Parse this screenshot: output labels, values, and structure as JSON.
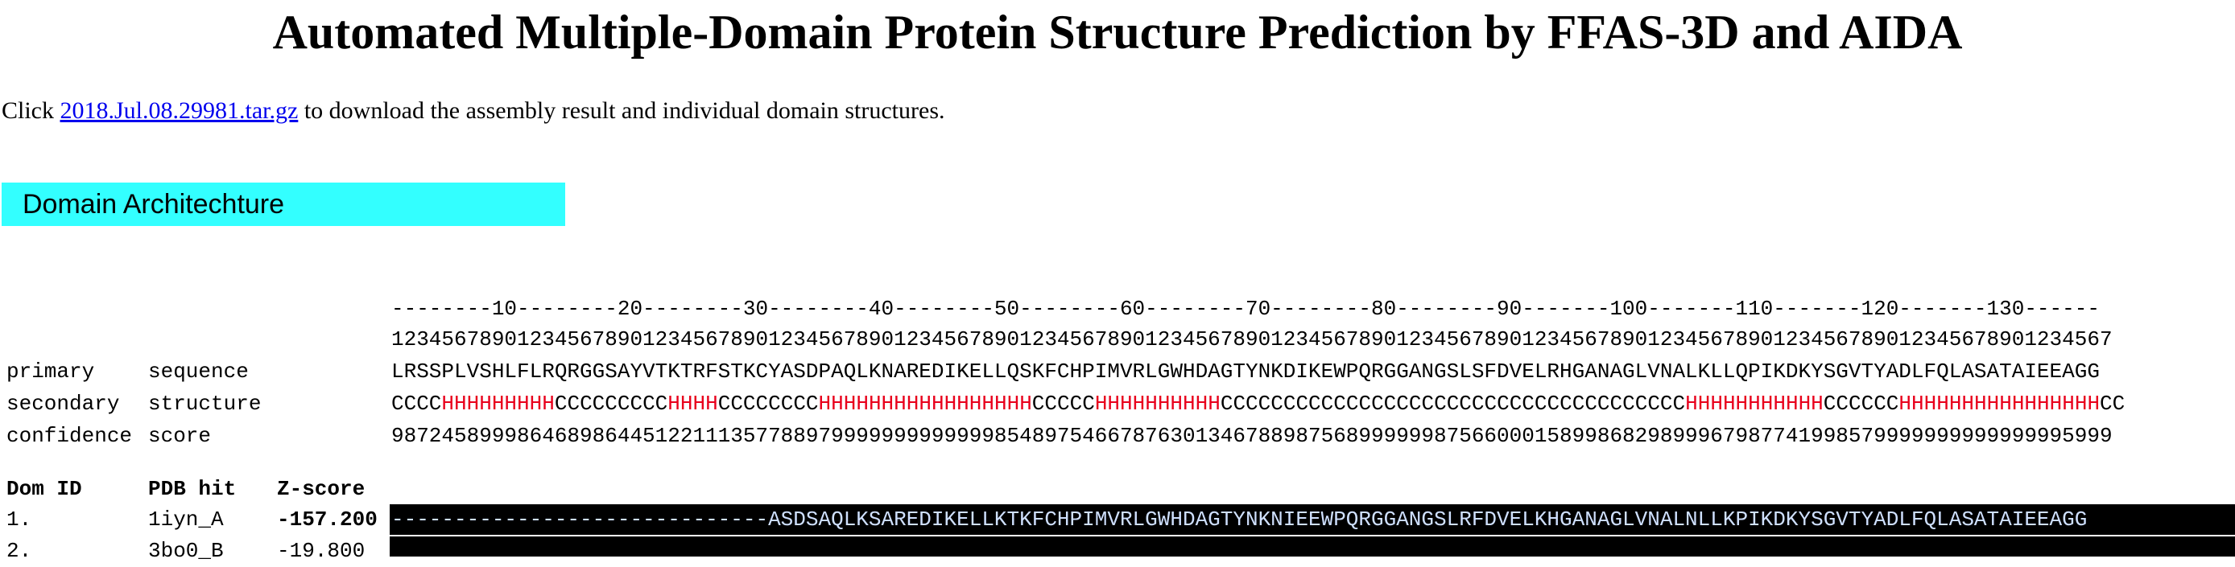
{
  "page": {
    "title": "Automated Multiple-Domain Protein Structure Prediction by FFAS-3D and AIDA",
    "intro_prefix": "Click ",
    "intro_link": "2018.Jul.08.29981.tar.gz",
    "intro_suffix": " to download the assembly result and individual domain structures."
  },
  "section": {
    "title": "Domain Architechture",
    "color": "#33ffff"
  },
  "ruler": {
    "tens": "--------10--------20--------30--------40--------50--------60--------70--------80--------90-------100-------110-------120-------130------",
    "units": "12345678901234567890123456789012345678901234567890123456789012345678901234567890123456789012345678901234567890123456789012345678901234567"
  },
  "primary": {
    "label1": "primary",
    "label2": "sequence",
    "value": "LRSSPLVSHLFLRQRGGSAYVTKTRFSTKCYASDPAQLKNAREDIKELLQSKFCHPIMVRLGWHDAGTYNKDIKEWPQRGGANGSLSFDVELRHGANAGLVNALKLLQPIKDKYSGVTYADLFQLASATAIEEAGG"
  },
  "secondary": {
    "label1": "secondary",
    "label2": "structure",
    "segments": [
      "CCCC",
      "HHHHHHHHH",
      "CCCCCCCCC",
      "HHHH",
      "CCCCCCCC",
      "HHHHHHHHHHHHHHHHH",
      "CCCCC",
      "HHHHHHHHHH",
      "CCCCCCCCCCCCCCCCCCCCCCCCCCCCCCCCCCCCC",
      "HHHHHHHHHHH",
      "CCCCCC",
      "HHHHHHHHHHHHHHHH",
      "CC"
    ],
    "helix_color": "#e8001c"
  },
  "confidence": {
    "label1": "confidence",
    "label2": "score",
    "value": "98724589998646898644512211135778897999999999999985489754667876301346788987568999999875660001589986829899967987741998579999999999999995999"
  },
  "hits": {
    "headers": {
      "dom_id": "Dom ID",
      "pdb_hit": "PDB hit",
      "zscore": "Z-score"
    },
    "rows": [
      {
        "dom_id": "1.",
        "pdb_hit": "1iyn_A",
        "zscore": "-157.200",
        "alignment": "------------------------------ASDSAQLKSAREDIKELLKTKFCHPIMVRLGWHDAGTYNKNIEEWPQRGGANGSLRFDVELKHGANAGLVNALNLLKPIKDKYSGVTYADLFQLASATAIEEAGG"
      },
      {
        "dom_id": "2.",
        "pdb_hit": "3bo0_B",
        "zscore": "-19.800",
        "alignment": ""
      }
    ]
  }
}
